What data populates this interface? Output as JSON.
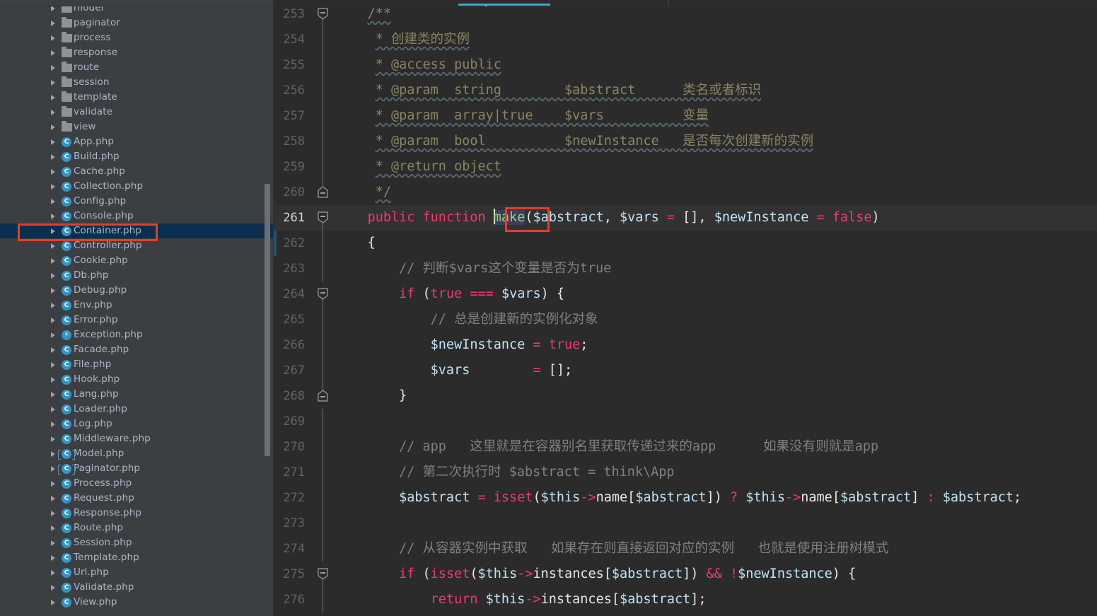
{
  "window": {
    "theme": "darcula",
    "accent_color": "#3ba7c4",
    "annotation_color": "#e83c2b",
    "selection_color": "#0d2f4f"
  },
  "tabs": {
    "active_tab_indicator": "cyan-underline"
  },
  "sidebar": {
    "name": "project-tree",
    "items": [
      {
        "label": "model",
        "icon": "folder-icon",
        "selected": false
      },
      {
        "label": "paginator",
        "icon": "folder-icon",
        "selected": false
      },
      {
        "label": "process",
        "icon": "folder-icon",
        "selected": false
      },
      {
        "label": "response",
        "icon": "folder-icon",
        "selected": false
      },
      {
        "label": "route",
        "icon": "folder-icon",
        "selected": false
      },
      {
        "label": "session",
        "icon": "folder-icon",
        "selected": false
      },
      {
        "label": "template",
        "icon": "folder-icon",
        "selected": false
      },
      {
        "label": "validate",
        "icon": "folder-icon",
        "selected": false
      },
      {
        "label": "view",
        "icon": "folder-icon",
        "selected": false
      },
      {
        "label": "App.php",
        "icon": "php-class-icon",
        "selected": false
      },
      {
        "label": "Build.php",
        "icon": "php-class-icon",
        "selected": false
      },
      {
        "label": "Cache.php",
        "icon": "php-class-icon",
        "selected": false
      },
      {
        "label": "Collection.php",
        "icon": "php-class-icon",
        "selected": false
      },
      {
        "label": "Config.php",
        "icon": "php-class-icon",
        "selected": false
      },
      {
        "label": "Console.php",
        "icon": "php-class-icon",
        "selected": false
      },
      {
        "label": "Container.php",
        "icon": "php-class-icon",
        "selected": true
      },
      {
        "label": "Controller.php",
        "icon": "php-class-icon",
        "selected": false
      },
      {
        "label": "Cookie.php",
        "icon": "php-class-icon",
        "selected": false
      },
      {
        "label": "Db.php",
        "icon": "php-class-icon",
        "selected": false
      },
      {
        "label": "Debug.php",
        "icon": "php-class-icon",
        "selected": false
      },
      {
        "label": "Env.php",
        "icon": "php-class-icon",
        "selected": false
      },
      {
        "label": "Error.php",
        "icon": "php-class-icon",
        "selected": false
      },
      {
        "label": "Exception.php",
        "icon": "php-exception-icon",
        "selected": false
      },
      {
        "label": "Facade.php",
        "icon": "php-class-icon",
        "selected": false
      },
      {
        "label": "File.php",
        "icon": "php-class-icon",
        "selected": false
      },
      {
        "label": "Hook.php",
        "icon": "php-class-icon",
        "selected": false
      },
      {
        "label": "Lang.php",
        "icon": "php-class-icon",
        "selected": false
      },
      {
        "label": "Loader.php",
        "icon": "php-class-icon",
        "selected": false
      },
      {
        "label": "Log.php",
        "icon": "php-class-icon",
        "selected": false
      },
      {
        "label": "Middleware.php",
        "icon": "php-class-icon",
        "selected": false
      },
      {
        "label": "Model.php",
        "icon": "php-abstract-class-icon",
        "selected": false
      },
      {
        "label": "Paginator.php",
        "icon": "php-abstract-class-icon",
        "selected": false
      },
      {
        "label": "Process.php",
        "icon": "php-class-icon",
        "selected": false
      },
      {
        "label": "Request.php",
        "icon": "php-class-icon",
        "selected": false
      },
      {
        "label": "Response.php",
        "icon": "php-class-icon",
        "selected": false
      },
      {
        "label": "Route.php",
        "icon": "php-class-icon",
        "selected": false
      },
      {
        "label": "Session.php",
        "icon": "php-class-icon",
        "selected": false
      },
      {
        "label": "Template.php",
        "icon": "php-class-icon",
        "selected": false
      },
      {
        "label": "Url.php",
        "icon": "php-class-icon",
        "selected": false
      },
      {
        "label": "Validate.php",
        "icon": "php-class-icon",
        "selected": false
      },
      {
        "label": "View.php",
        "icon": "php-class-icon",
        "selected": false
      }
    ],
    "class_icon_letter": "C",
    "exception_icon_glyph": "⚡"
  },
  "editor": {
    "name": "code-editor",
    "first_visible_line": 253,
    "current_line": 261,
    "selected_token": "make",
    "lines": [
      {
        "n": "253",
        "fold": "start",
        "mark": ""
      },
      {
        "n": "254",
        "fold": "mid",
        "mark": ""
      },
      {
        "n": "255",
        "fold": "mid",
        "mark": ""
      },
      {
        "n": "256",
        "fold": "mid",
        "mark": ""
      },
      {
        "n": "257",
        "fold": "mid",
        "mark": ""
      },
      {
        "n": "258",
        "fold": "mid",
        "mark": ""
      },
      {
        "n": "259",
        "fold": "mid",
        "mark": ""
      },
      {
        "n": "260",
        "fold": "end",
        "mark": ""
      },
      {
        "n": "261",
        "fold": "start",
        "mark": "",
        "current": true
      },
      {
        "n": "262",
        "fold": "line",
        "mark": "blue"
      },
      {
        "n": "263",
        "fold": "line",
        "mark": ""
      },
      {
        "n": "264",
        "fold": "start",
        "mark": ""
      },
      {
        "n": "265",
        "fold": "mid",
        "mark": ""
      },
      {
        "n": "266",
        "fold": "mid",
        "mark": ""
      },
      {
        "n": "267",
        "fold": "mid",
        "mark": ""
      },
      {
        "n": "268",
        "fold": "end",
        "mark": ""
      },
      {
        "n": "269",
        "fold": "line",
        "mark": ""
      },
      {
        "n": "270",
        "fold": "line",
        "mark": ""
      },
      {
        "n": "271",
        "fold": "line",
        "mark": ""
      },
      {
        "n": "272",
        "fold": "line",
        "mark": ""
      },
      {
        "n": "273",
        "fold": "line",
        "mark": ""
      },
      {
        "n": "274",
        "fold": "line",
        "mark": ""
      },
      {
        "n": "275",
        "fold": "start",
        "mark": ""
      },
      {
        "n": "276",
        "fold": "mid",
        "mark": ""
      }
    ],
    "source": {
      "l253": "/**",
      "l254_star": "*",
      "l254_text": "创建类的实例",
      "l255_star": "*",
      "l255_tag": "@access",
      "l255_val": "public",
      "l256_star": "*",
      "l256_tag": "@param",
      "l256_type": "string",
      "l256_var": "$abstract",
      "l256_desc": "类名或者标识",
      "l257_star": "*",
      "l257_tag": "@param",
      "l257_type": "array|true",
      "l257_var": "$vars",
      "l257_desc": "变量",
      "l258_star": "*",
      "l258_tag": "@param",
      "l258_type": "bool",
      "l258_var": "$newInstance",
      "l258_desc": "是否每次创建新的实例",
      "l259_star": "*",
      "l259_tag": "@return",
      "l259_type": "object",
      "l260": "*/",
      "l261_public": "public",
      "l261_function": "function",
      "l261_make": "make",
      "l261_rest_a": "(",
      "l261_abstract": "$abstract",
      "l261_comma1": ", ",
      "l261_vars": "$vars",
      "l261_eq1": "=",
      "l261_empty_arr": "[]",
      "l261_comma2": ", ",
      "l261_newinst": "$newInstance",
      "l261_eq2": "=",
      "l261_false": "false",
      "l261_close": ")",
      "l262": "{",
      "l263": "// 判断$vars这个变量是否为true",
      "l264_if": "if",
      "l264_true": "true",
      "l264_eq": "===",
      "l264_vars": "$vars",
      "l264_tail": ") {",
      "l265": "// 总是创建新的实例化对象",
      "l266_var": "$newInstance",
      "l266_eq": "=",
      "l266_true": "true",
      "l266_semi": ";",
      "l267_var": "$vars",
      "l267_eq": "=",
      "l267_arr": "[]",
      "l267_semi": ";",
      "l268": "}",
      "l270": "// app   这里就是在容器别名里获取传递过来的app      如果没有则就是app",
      "l271": "// 第二次执行时 $abstract = think\\App",
      "l272_var": "$abstract",
      "l272_eq": "=",
      "l272_isset": "isset",
      "l272_this": "$this",
      "l272_arrow": "->",
      "l272_name": "name",
      "l272_idx": "[$abstract]",
      "l272_q": "?",
      "l272_colon": ":",
      "l272_semi": ";",
      "l274": "// 从容器实例中获取   如果存在则直接返回对应的实例   也就是使用注册树模式",
      "l275_if": "if",
      "l275_isset": "isset",
      "l275_this": "$this",
      "l275_arrow": "->",
      "l275_instances": "instances",
      "l275_idx": "[$abstract]",
      "l275_and": "&&",
      "l275_not": "!",
      "l275_newinst": "$newInstance",
      "l275_tail": ") {",
      "l276_return": "return",
      "l276_this": "$this",
      "l276_arrow": "->",
      "l276_instances": "instances",
      "l276_idx": "[$abstract]",
      "l276_semi": ";"
    }
  }
}
